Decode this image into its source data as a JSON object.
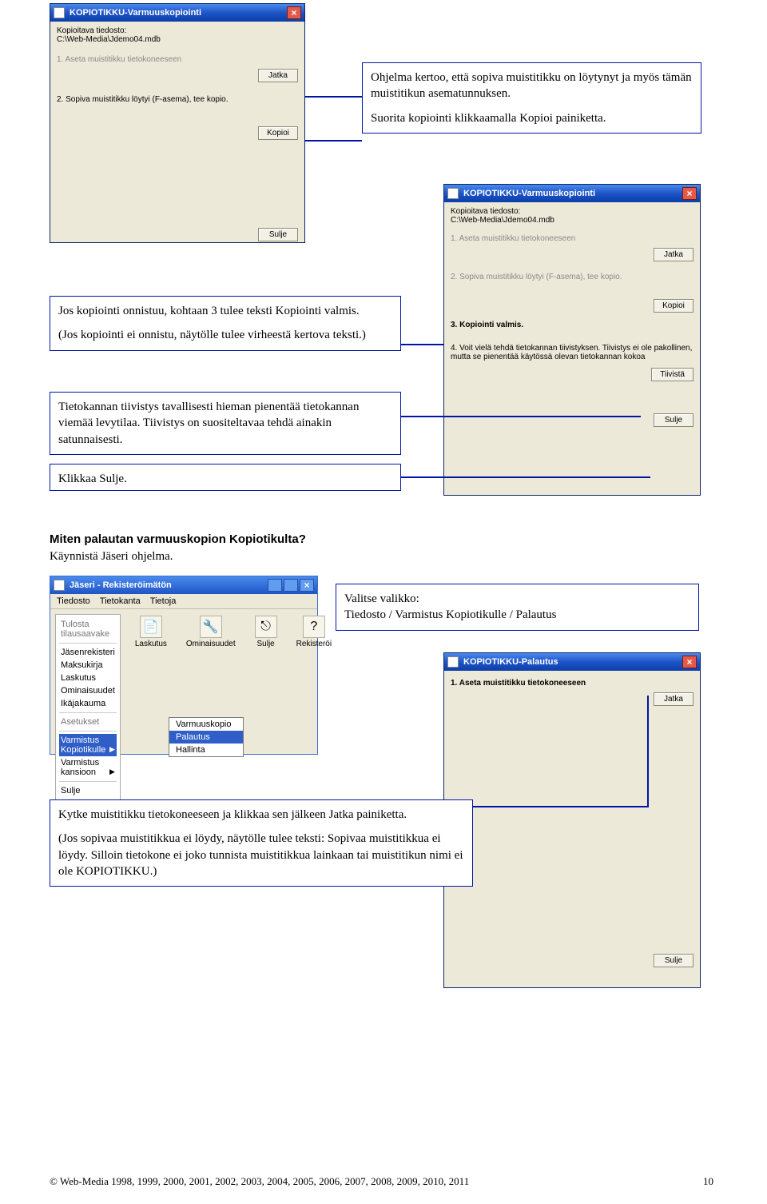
{
  "dlg1": {
    "title": "KOPIOTIKKU-Varmuuskopiointi",
    "file_label": "Kopioitava tiedosto:",
    "file_path": "C:\\Web-Media\\Jdemo04.mdb",
    "step1": "1. Aseta muistitikku tietokoneeseen",
    "btn_jatka": "Jatka",
    "step2": "2. Sopiva muistitikku löytyi (F-asema), tee kopio.",
    "btn_kopioi": "Kopioi",
    "btn_sulje": "Sulje"
  },
  "note1": {
    "p1": "Ohjelma kertoo, että sopiva muistitikku on löytynyt ja myös tämän muistitikun asematunnuksen.",
    "p2": "Suorita kopiointi klikkaamalla Kopioi painiketta."
  },
  "dlg2": {
    "title": "KOPIOTIKKU-Varmuuskopiointi",
    "file_label": "Kopioitava tiedosto:",
    "file_path": "C:\\Web-Media\\Jdemo04.mdb",
    "step1": "1. Aseta muistitikku tietokoneeseen",
    "btn_jatka": "Jatka",
    "step2": "2. Sopiva muistitikku löytyi (F-asema), tee kopio.",
    "btn_kopioi": "Kopioi",
    "step3": "3. Kopiointi valmis.",
    "step4": "4. Voit vielä tehdä tietokannan tiivistyksen. Tiivistys ei ole pakollinen, mutta se pienentää käytössä olevan tietokannan kokoa",
    "btn_tiivista": "Tiivistä",
    "btn_sulje": "Sulje"
  },
  "note2": {
    "p1": "Jos kopiointi onnistuu, kohtaan 3 tulee teksti Kopiointi valmis.",
    "p2": "(Jos kopiointi ei onnistu, näytölle tulee virheestä kertova teksti.)"
  },
  "note3": {
    "t": "Tietokannan tiivistys tavallisesti hieman pienentää tietokannan viemää levytilaa. Tiivistys on suositeltavaa tehdä ainakin satunnaisesti."
  },
  "note4": {
    "t": "Klikkaa Sulje."
  },
  "section": {
    "heading": "Miten palautan varmuuskopion Kopiotikulta?",
    "body": "Käynnistä Jäseri ohjelma."
  },
  "jaseri": {
    "title": "Jäseri - Rekisteröimätön",
    "menus": [
      "Tiedosto",
      "Tietokanta",
      "Tietoja"
    ],
    "toolbar": [
      "Laskutus",
      "Ominaisuudet",
      "Sulje",
      "Rekisteröi"
    ],
    "side_group1": "Tulosta tilausaavake",
    "side_items1": [
      "Jäsenrekisteri",
      "Maksukirja",
      "Laskutus",
      "Ominaisuudet",
      "Ikäjakauma"
    ],
    "side_items2_label": "Asetukset",
    "side_varmistus": "Varmistus Kopiotikulle",
    "side_varmistus_kansioon": "Varmistus kansioon",
    "side_sulje": "Sulje",
    "submenu": [
      "Varmuuskopio",
      "Palautus",
      "Hallinta"
    ]
  },
  "note5": {
    "l1": "Valitse valikko:",
    "l2": "Tiedosto / Varmistus Kopiotikulle / Palautus"
  },
  "dlg3": {
    "title": "KOPIOTIKKU-Palautus",
    "step1": "1. Aseta muistitikku tietokoneeseen",
    "btn_jatka": "Jatka",
    "btn_sulje": "Sulje"
  },
  "note6": {
    "p1": "Kytke muistitikku tietokoneeseen ja klikkaa sen jälkeen Jatka painiketta.",
    "p2": "(Jos sopivaa muistitikkua ei löydy, näytölle tulee teksti: Sopivaa muistitikkua ei löydy. Silloin tietokone ei joko tunnista muistitikkua lainkaan tai muistitikun nimi ei ole KOPIOTIKKU.)"
  },
  "footer": "© Web-Media 1998, 1999, 2000, 2001, 2002, 2003, 2004, 2005, 2006, 2007, 2008, 2009, 2010, 2011",
  "page_number": "10"
}
